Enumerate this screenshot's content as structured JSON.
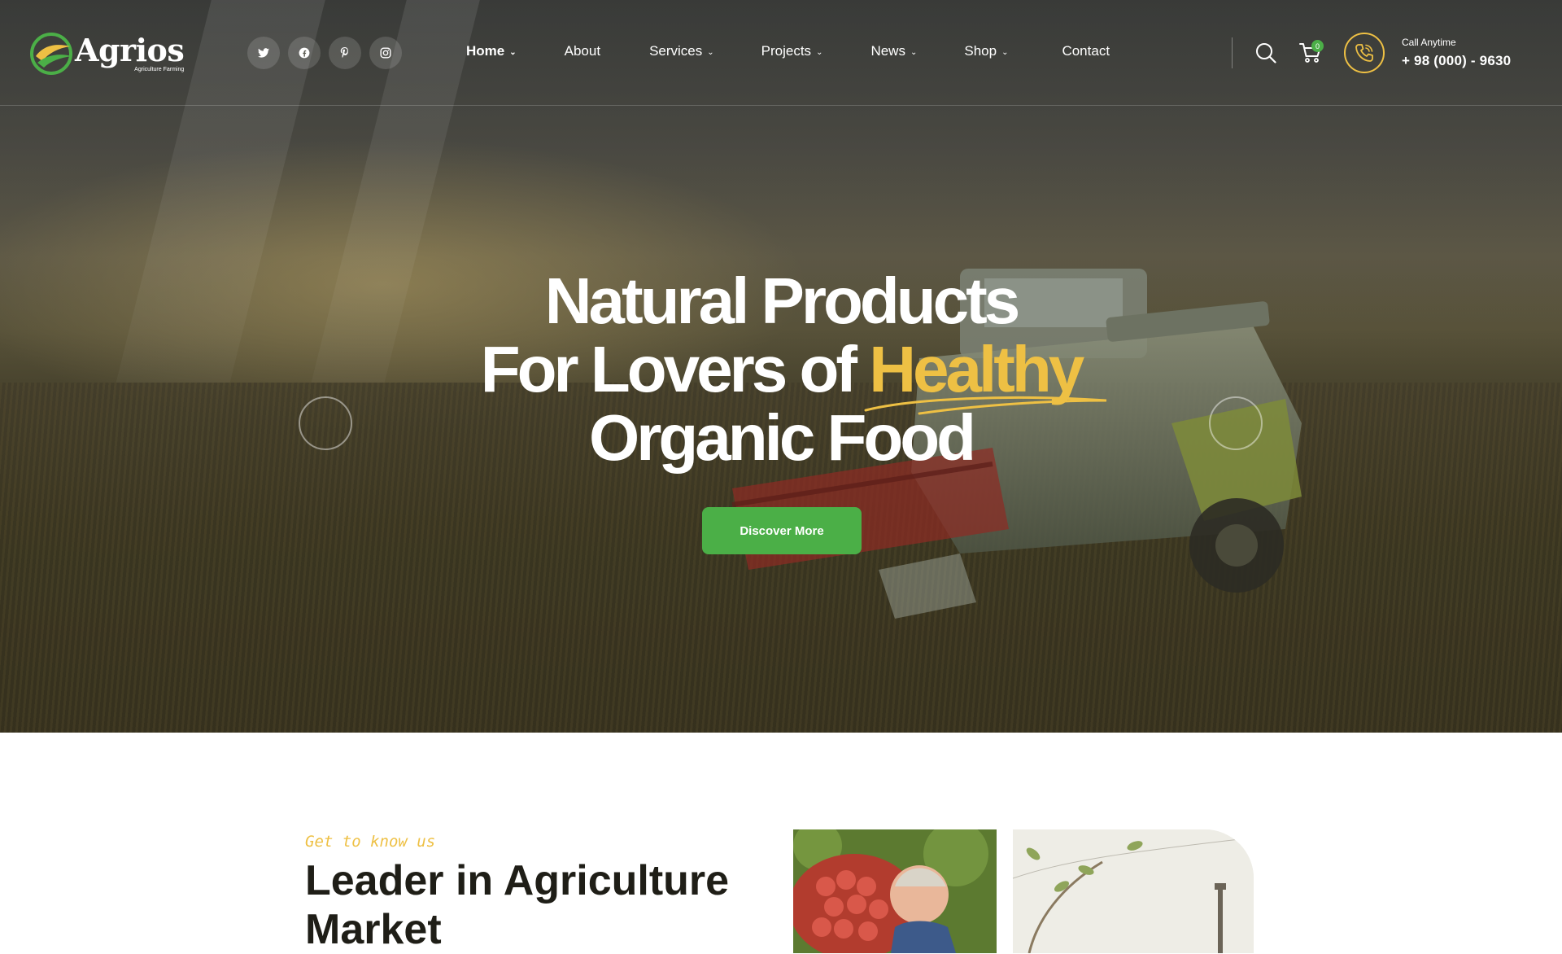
{
  "brand": {
    "name": "Agrios",
    "tagline": "Agriculture Farming",
    "colors": {
      "green": "#4baf47",
      "yellow": "#eec044",
      "dark": "#1f1e17"
    }
  },
  "header": {
    "socials": [
      {
        "icon": "twitter-icon",
        "glyph": "𝕥"
      },
      {
        "icon": "facebook-icon",
        "glyph": "f"
      },
      {
        "icon": "pinterest-icon",
        "glyph": "P"
      },
      {
        "icon": "instagram-icon",
        "glyph": "◎"
      }
    ],
    "nav": [
      {
        "label": "Home",
        "dropdown": true,
        "active": true
      },
      {
        "label": "About",
        "dropdown": false
      },
      {
        "label": "Services",
        "dropdown": true
      },
      {
        "label": "Projects",
        "dropdown": true
      },
      {
        "label": "News",
        "dropdown": true
      },
      {
        "label": "Shop",
        "dropdown": true
      },
      {
        "label": "Contact",
        "dropdown": false
      }
    ],
    "cart_count": "0",
    "call_label": "Call Anytime",
    "call_number": "+ 98 (000) - 9630"
  },
  "hero": {
    "line1": "Natural Products",
    "line2_prefix": "For Lovers of ",
    "line2_accent": "Healthy",
    "line3": "Organic Food",
    "button_label": "Discover More"
  },
  "about": {
    "tagline": "Get to know us",
    "title": "Leader in Agriculture Market"
  }
}
